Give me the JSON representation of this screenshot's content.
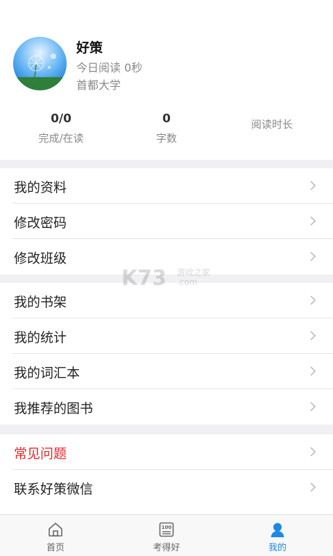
{
  "profile": {
    "name": "好策",
    "today_reading": "今日阅读 0秒",
    "school": "首都大学"
  },
  "stats": [
    {
      "value": "0/0",
      "label": "完成/在读"
    },
    {
      "value": "0",
      "label": "字数"
    },
    {
      "value": "",
      "label": "阅读时长"
    }
  ],
  "menu_group_1": [
    {
      "label": "我的资料"
    },
    {
      "label": "修改密码"
    },
    {
      "label": "修改班级"
    }
  ],
  "menu_group_2": [
    {
      "label": "我的书架"
    },
    {
      "label": "我的统计"
    },
    {
      "label": "我的词汇本"
    },
    {
      "label": "我推荐的图书"
    }
  ],
  "menu_group_3": [
    {
      "label": "常见问题"
    },
    {
      "label": "联系好策微信"
    }
  ],
  "tabbar": [
    {
      "label": "首页",
      "icon": "home-icon"
    },
    {
      "label": "考得好",
      "icon": "score-icon"
    },
    {
      "label": "我的",
      "icon": "user-icon"
    }
  ],
  "watermark": {
    "brand": "K73",
    "site": "游戏之家",
    "domain": ".com"
  },
  "colors": {
    "accent": "#1e88e5",
    "danger": "#e8262a",
    "separator": "#efeff4"
  }
}
